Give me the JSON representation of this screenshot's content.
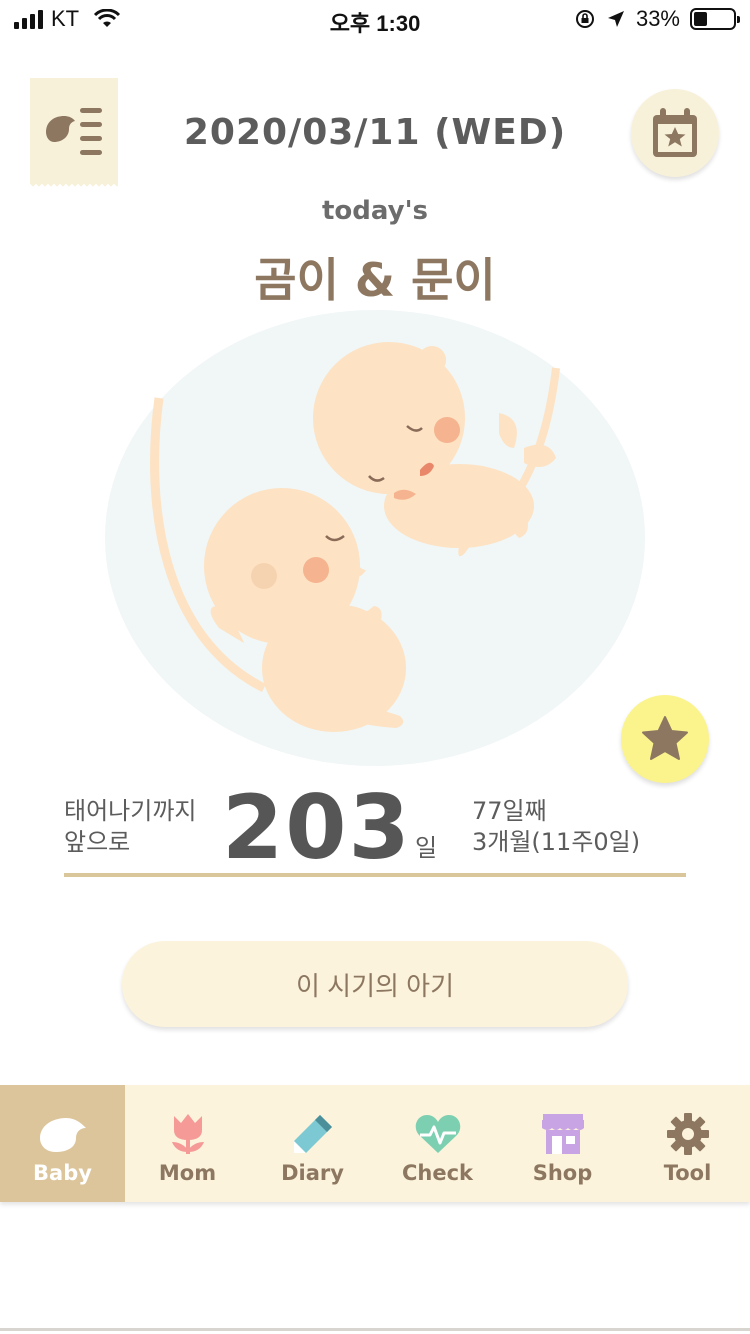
{
  "status_bar": {
    "carrier": "KT",
    "time": "오후 1:30",
    "battery": "33%",
    "battery_level": 0.33
  },
  "header": {
    "date": "2020/03/11 (WED)",
    "today_label": "today's",
    "baby_names": "곰이 & 문이"
  },
  "countdown": {
    "label_line1": "태어나기까지",
    "label_line2": "앞으로",
    "days": "203",
    "unit": "일",
    "info_line1": "77일째",
    "info_line2": "3개월(11주0일)"
  },
  "period_button": {
    "label": "이 시기의 아기"
  },
  "tabs": [
    {
      "label": "Baby",
      "icon": "bird-icon",
      "active": true
    },
    {
      "label": "Mom",
      "icon": "tulip-icon",
      "active": false
    },
    {
      "label": "Diary",
      "icon": "pencil-icon",
      "active": false
    },
    {
      "label": "Check",
      "icon": "heart-pulse-icon",
      "active": false
    },
    {
      "label": "Shop",
      "icon": "shop-icon",
      "active": false
    },
    {
      "label": "Tool",
      "icon": "gear-icon",
      "active": false
    }
  ],
  "colors": {
    "brown": "#8d7761",
    "cream": "#fbf3dc",
    "active_tab": "#dcc59a",
    "favorite": "#fbf38c",
    "mom_pink": "#f59a97",
    "diary_teal": "#7cc8d3",
    "check_green": "#7ccfb1",
    "shop_purple": "#c9a4e4"
  }
}
